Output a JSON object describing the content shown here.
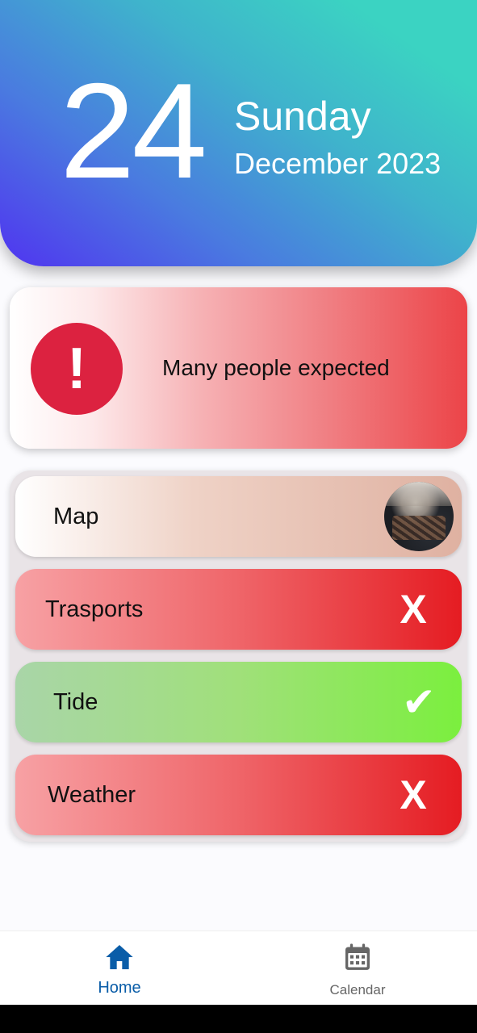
{
  "header": {
    "day_number": "24",
    "weekday": "Sunday",
    "month_year": "December 2023"
  },
  "alert": {
    "icon": "exclamation-icon",
    "symbol": "!",
    "message": "Many people expected"
  },
  "items": [
    {
      "label": "Map",
      "status": "image",
      "icon": "map-thumbnail"
    },
    {
      "label": "Trasports",
      "status": "negative",
      "symbol": "X",
      "icon": "x-icon"
    },
    {
      "label": "Tide",
      "status": "positive",
      "symbol": "✔",
      "icon": "checkmark-icon"
    },
    {
      "label": "Weather",
      "status": "negative",
      "symbol": "X",
      "icon": "x-icon"
    }
  ],
  "bottom_nav": {
    "home_label": "Home",
    "calendar_label": "Calendar",
    "active": "Home"
  },
  "colors": {
    "accent": "#0a5da8",
    "alert_red": "#dc2240",
    "negative": "#e51c22",
    "positive": "#7bef3e"
  }
}
